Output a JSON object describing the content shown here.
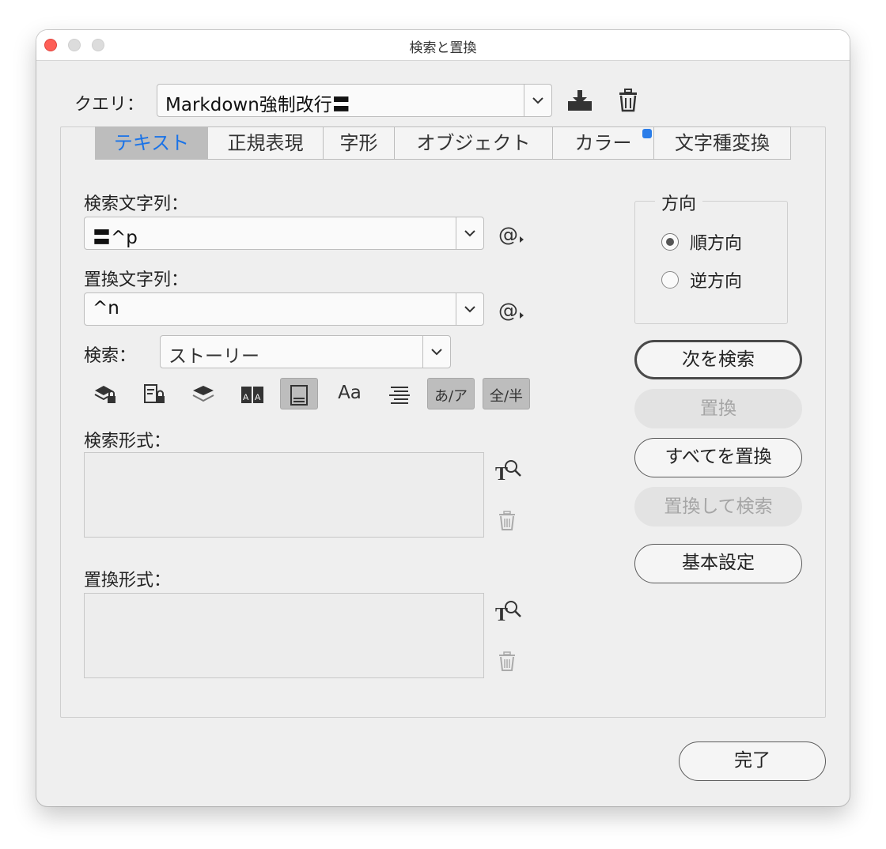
{
  "window": {
    "title": "検索と置換"
  },
  "query": {
    "label": "クエリ：",
    "value": "Markdown強制改行〓"
  },
  "tabs": [
    {
      "label": "テキスト",
      "active": true
    },
    {
      "label": "正規表現",
      "active": false
    },
    {
      "label": "字形",
      "active": false
    },
    {
      "label": "オブジェクト",
      "active": false
    },
    {
      "label": "カラー",
      "active": false,
      "badge": true
    },
    {
      "label": "文字種変換",
      "active": false
    }
  ],
  "find": {
    "label": "検索文字列：",
    "value": "〓^p",
    "special_char_label": "@"
  },
  "replace": {
    "label": "置換文字列：",
    "value": "^n",
    "special_char_label": "@"
  },
  "search_scope": {
    "label": "検索：",
    "value": "ストーリー"
  },
  "toolbar_icons": [
    {
      "name": "include-locked-layers-icon",
      "on": false
    },
    {
      "name": "include-locked-stories-icon",
      "on": false
    },
    {
      "name": "include-hidden-layers-icon",
      "on": false
    },
    {
      "name": "include-master-pages-icon",
      "on": false
    },
    {
      "name": "include-footnotes-icon",
      "on": true
    },
    {
      "name": "case-sensitive-icon",
      "on": false,
      "text": "Aa"
    },
    {
      "name": "whole-word-icon",
      "on": false
    },
    {
      "name": "kana-sensitive-icon",
      "on": true,
      "text": "あ/ア"
    },
    {
      "name": "full-half-width-sensitive-icon",
      "on": true,
      "text": "全/半"
    }
  ],
  "find_format": {
    "label": "検索形式："
  },
  "replace_format": {
    "label": "置換形式："
  },
  "direction": {
    "title": "方向",
    "options": [
      {
        "label": "順方向",
        "selected": true
      },
      {
        "label": "逆方向",
        "selected": false
      }
    ]
  },
  "buttons": {
    "find_next": "次を検索",
    "replace": "置換",
    "replace_all": "すべてを置換",
    "replace_find": "置換して検索",
    "basic_settings": "基本設定",
    "done": "完了"
  },
  "colors": {
    "accent": "#1a73e8",
    "badge": "#2b7de9",
    "close": "#fe5f57"
  }
}
